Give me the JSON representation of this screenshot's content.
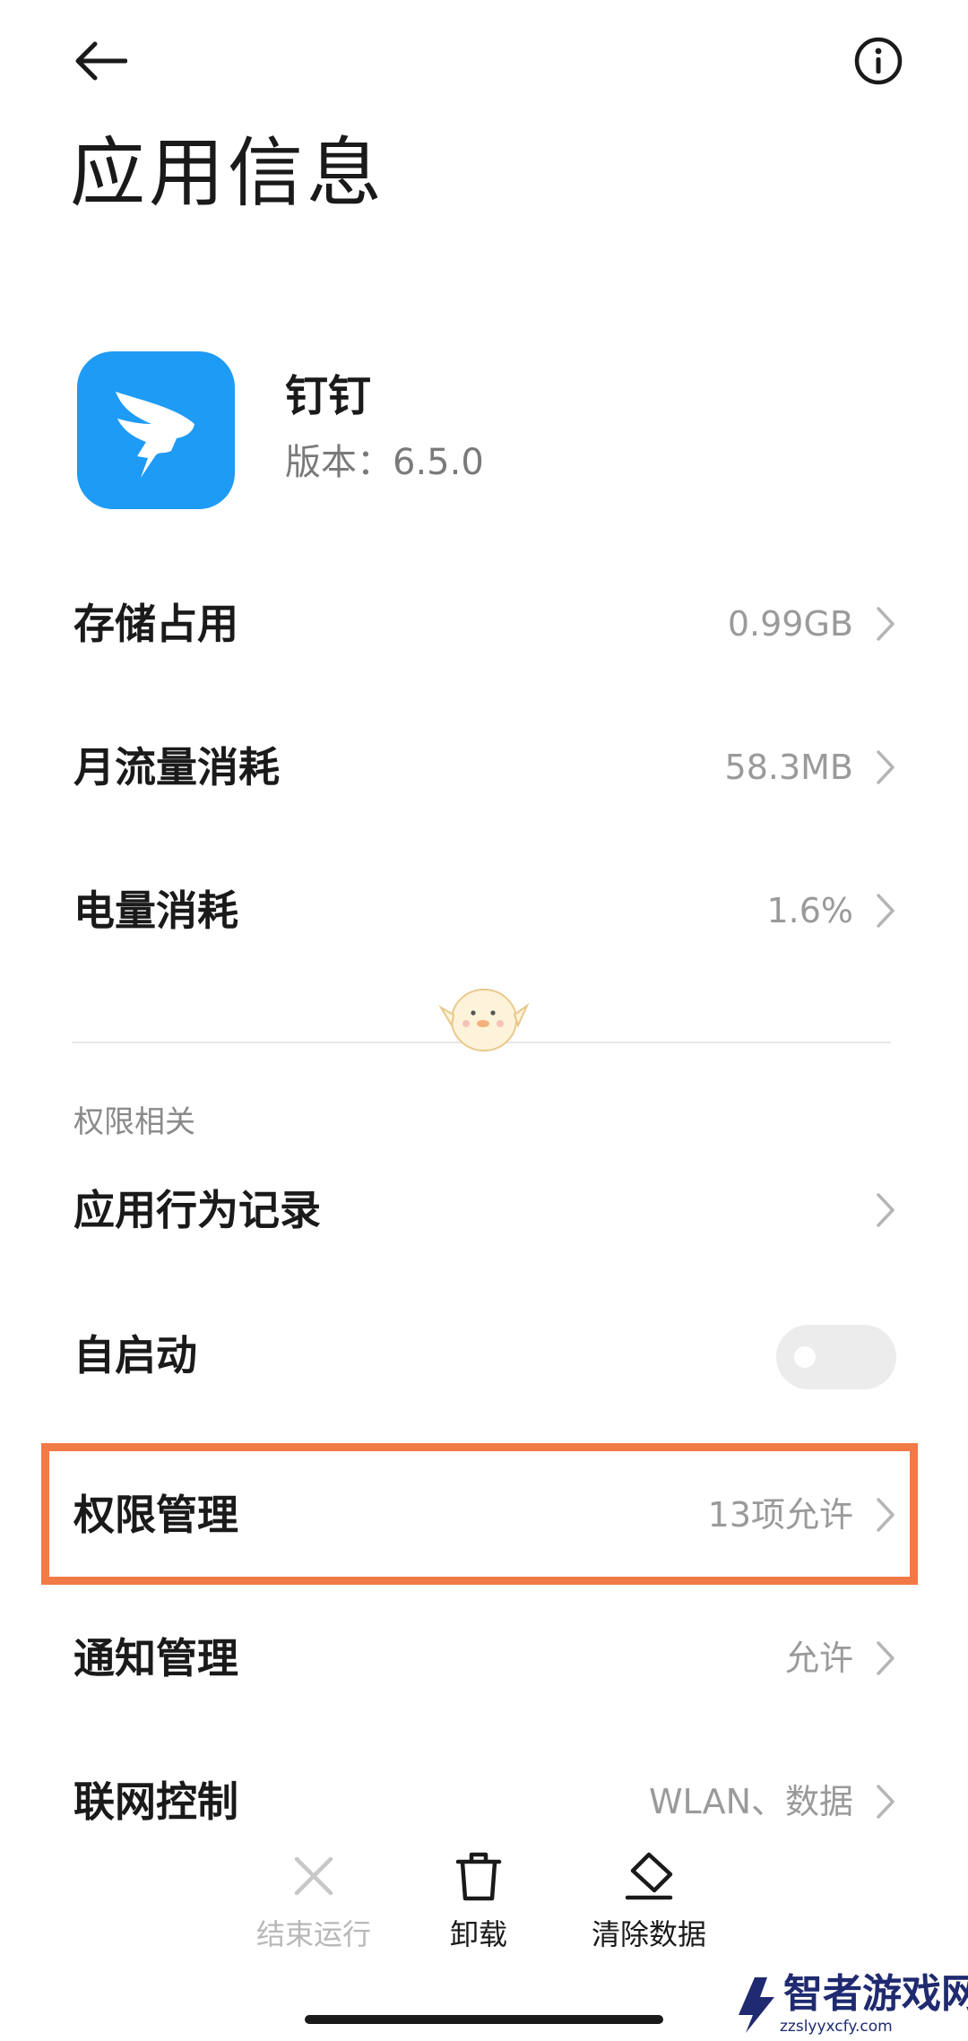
{
  "header": {
    "title": "应用信息"
  },
  "app": {
    "name": "钉钉",
    "version": "版本：6.5.0",
    "icon_color": "#1e9bf5"
  },
  "usage_rows": [
    {
      "label": "存储占用",
      "value": "0.99GB"
    },
    {
      "label": "月流量消耗",
      "value": "58.3MB"
    },
    {
      "label": "电量消耗",
      "value": "1.6%"
    }
  ],
  "permissions": {
    "section_title": "权限相关",
    "behavior_log": {
      "label": "应用行为记录"
    },
    "autostart": {
      "label": "自启动",
      "enabled": false
    },
    "permission_manage": {
      "label": "权限管理",
      "value": "13项允许"
    },
    "notification_manage": {
      "label": "通知管理",
      "value": "允许"
    },
    "network_control": {
      "label": "联网控制",
      "value": "WLAN、数据"
    }
  },
  "bottom_bar": {
    "stop": {
      "label": "结束运行",
      "enabled": false
    },
    "uninstall": {
      "label": "卸载"
    },
    "clear_data": {
      "label": "清除数据"
    }
  },
  "watermark": {
    "title": "智者游戏网",
    "url": "zzslyyxcfy.com"
  },
  "colors": {
    "highlight": "#f17a46",
    "secondary_text": "#9a9a9a",
    "brand_blue": "#1e9bf5"
  }
}
